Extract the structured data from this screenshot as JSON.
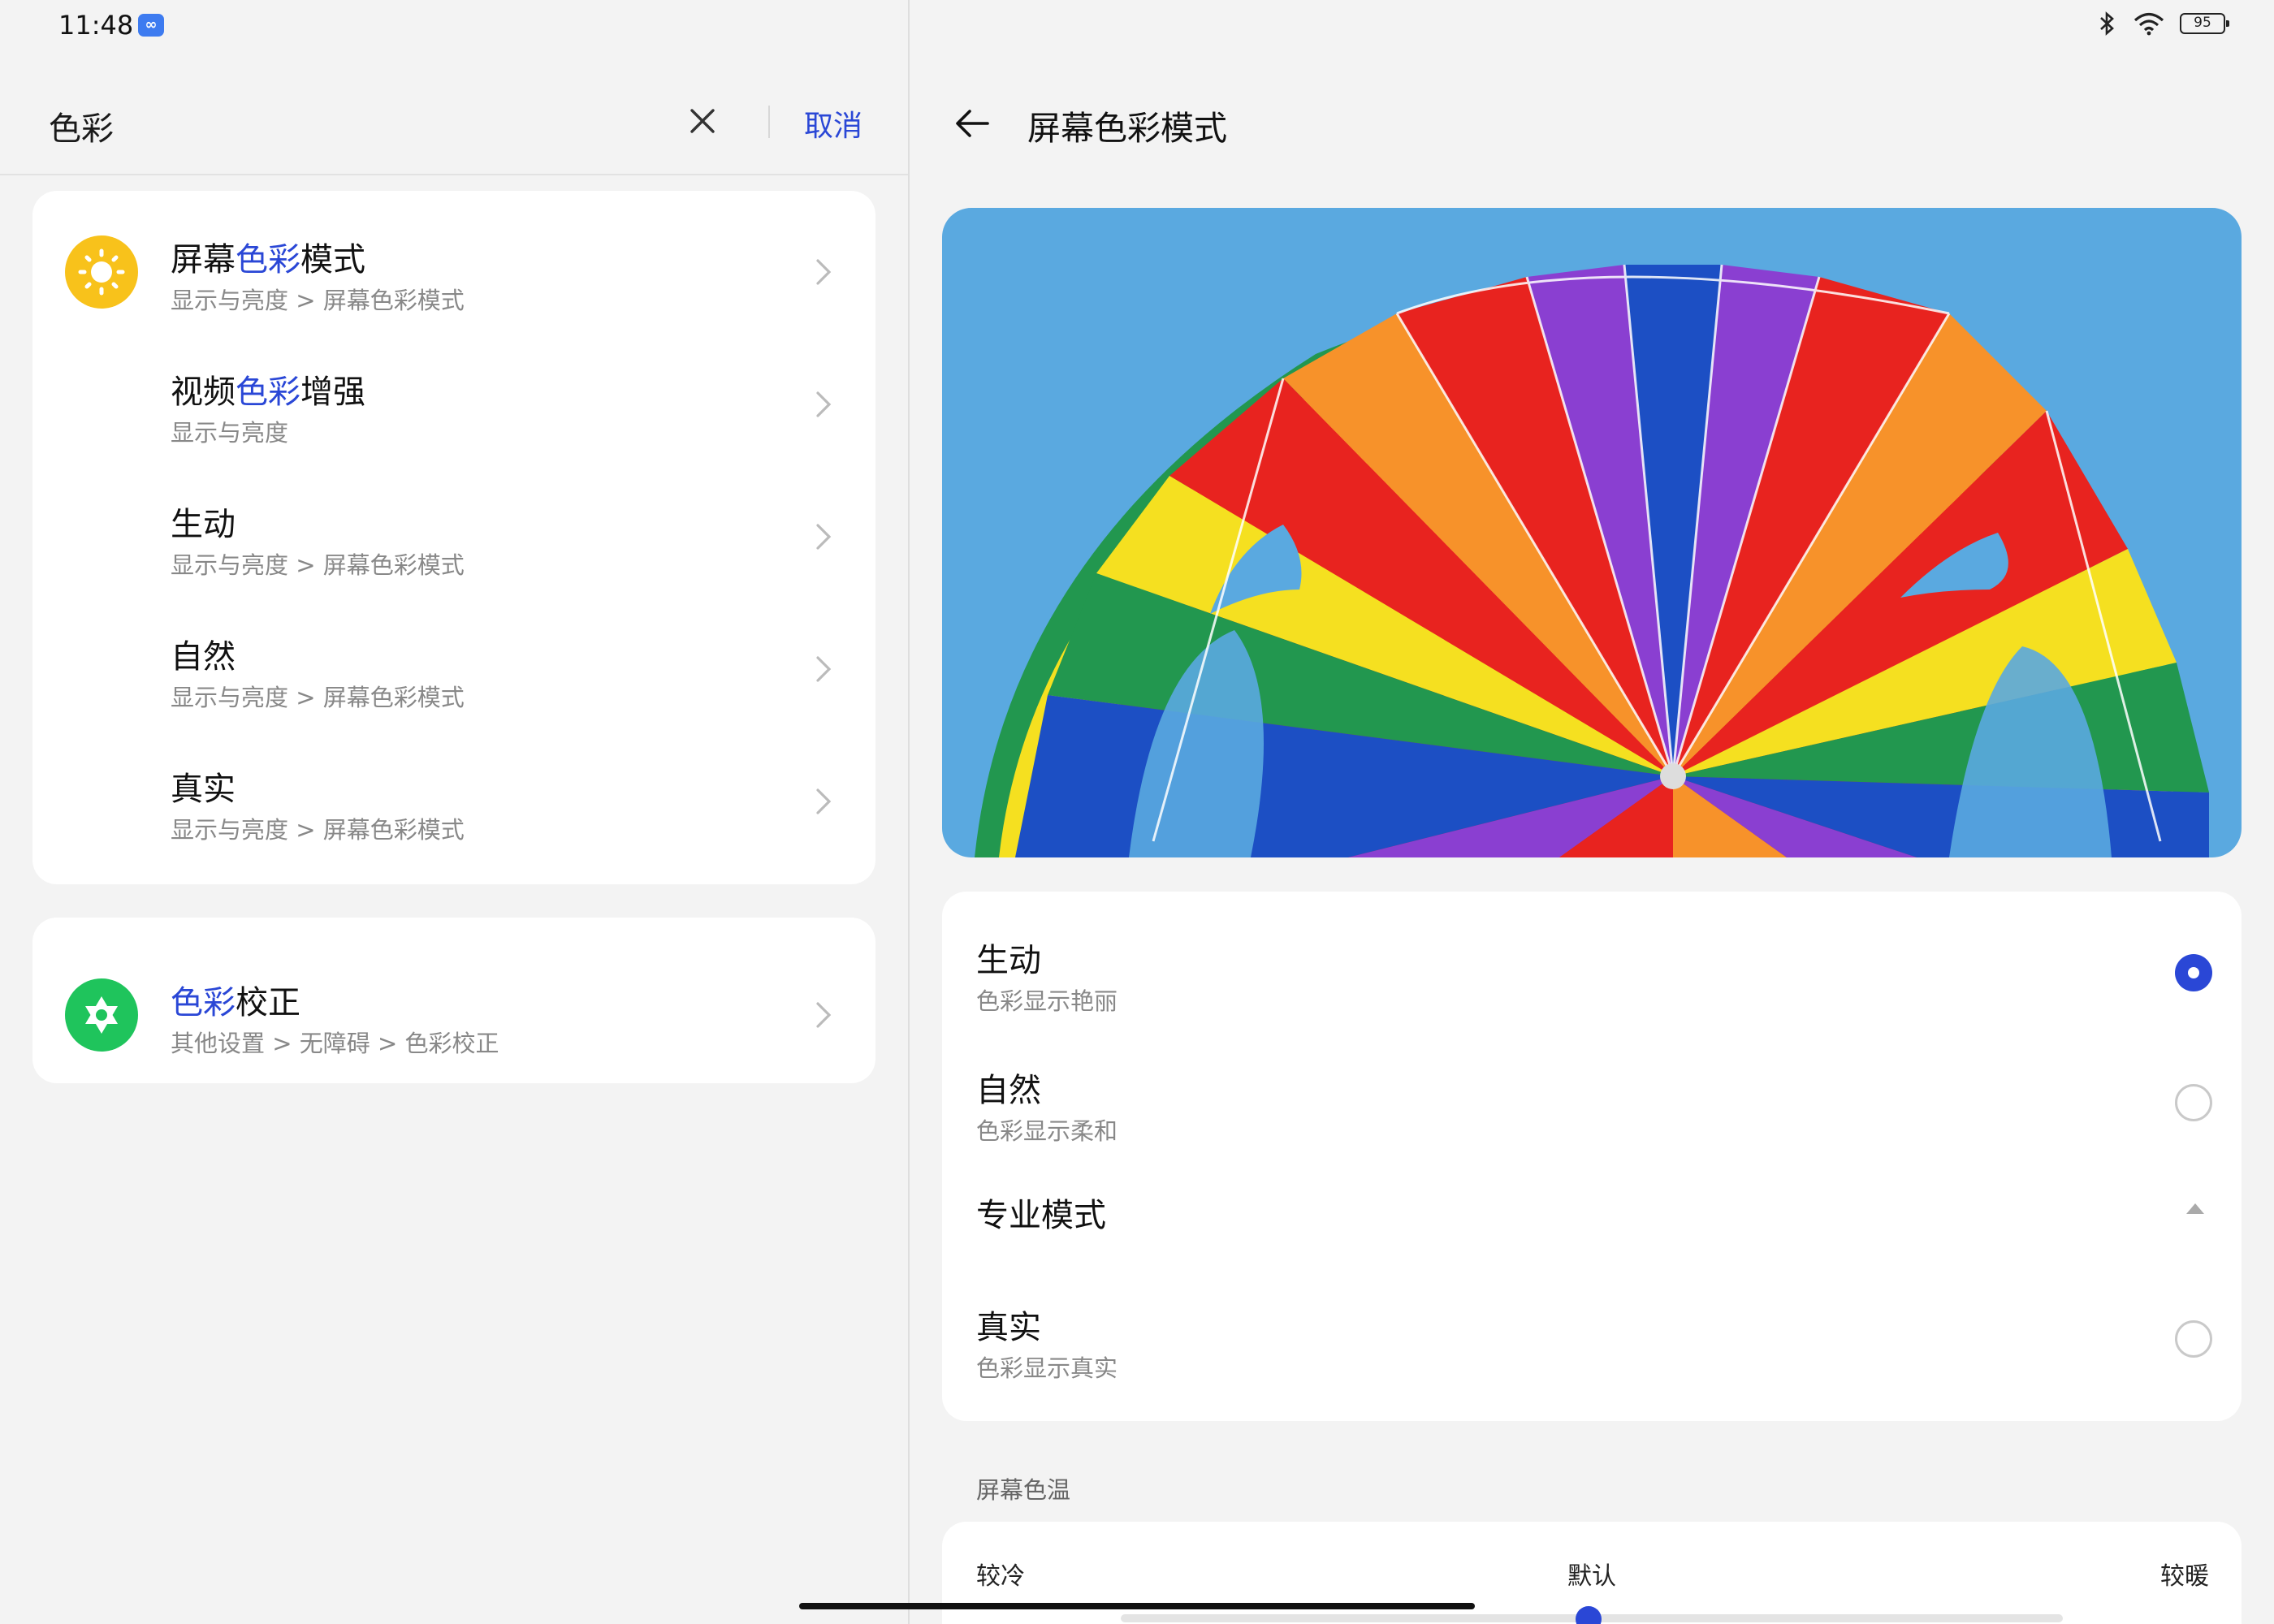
{
  "status_bar": {
    "time": "11:48",
    "notification_icon": "infinity-icon",
    "battery": "95"
  },
  "search": {
    "query": "色彩",
    "cancel_label": "取消"
  },
  "results": [
    {
      "title_pre": "屏幕",
      "title_hl": "色彩",
      "title_post": "模式",
      "path": "显示与亮度 > 屏幕色彩模式",
      "icon": "brightness-icon",
      "icon_color": "#f8c21b"
    },
    {
      "title_pre": "视频",
      "title_hl": "色彩",
      "title_post": "增强",
      "path": "显示与亮度",
      "icon": "",
      "icon_color": ""
    },
    {
      "title_pre": "生动",
      "title_hl": "",
      "title_post": "",
      "path": "显示与亮度 > 屏幕色彩模式",
      "icon": "",
      "icon_color": ""
    },
    {
      "title_pre": "自然",
      "title_hl": "",
      "title_post": "",
      "path": "显示与亮度 > 屏幕色彩模式",
      "icon": "",
      "icon_color": ""
    },
    {
      "title_pre": "真实",
      "title_hl": "",
      "title_post": "",
      "path": "显示与亮度 > 屏幕色彩模式",
      "icon": "",
      "icon_color": ""
    }
  ],
  "results2": [
    {
      "title_pre": "",
      "title_hl": "色彩",
      "title_post": "校正",
      "path": "其他设置 > 无障碍 > 色彩校正",
      "icon": "accessibility-icon",
      "icon_color": "#1fc45c"
    }
  ],
  "detail": {
    "title": "屏幕色彩模式",
    "modes": [
      {
        "title": "生动",
        "subtitle": "色彩显示艳丽",
        "selected": true
      },
      {
        "title": "自然",
        "subtitle": "色彩显示柔和",
        "selected": false
      }
    ],
    "pro_mode": {
      "title": "专业模式",
      "expanded": true
    },
    "pro_options": [
      {
        "title": "真实",
        "subtitle": "色彩显示真实",
        "selected": false
      }
    ],
    "temperature": {
      "section_label": "屏幕色温",
      "cool_label": "较冷",
      "default_label": "默认",
      "warm_label": "较暖",
      "value": 0.5
    }
  },
  "colors": {
    "accent": "#2a47d6",
    "sky": "#5aa9e0"
  }
}
